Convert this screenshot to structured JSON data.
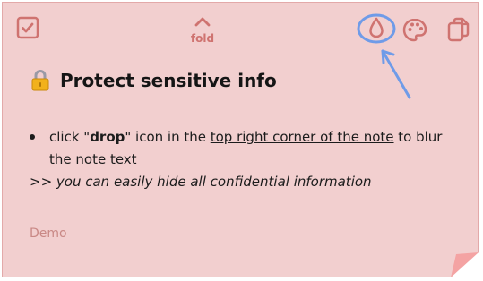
{
  "toolbar": {
    "check_icon": "checkbox-check-icon",
    "fold_icon": "chevron-up-icon",
    "fold_label": "fold",
    "drop_icon": "water-drop-icon",
    "palette_icon": "palette-icon",
    "copy_icon": "copy-icon"
  },
  "note": {
    "title_icon": "lock-icon",
    "title": "Protect sensitive info",
    "bullet_prefix": "click \"",
    "bullet_bold": "drop",
    "bullet_middle": "\" icon in the ",
    "bullet_link": "top right corner of the note",
    "bullet_suffix": " to blur the note text",
    "hint": ">> you can easily hide all confidential information",
    "tag": "Demo"
  },
  "colors": {
    "background": "#f2cfcf",
    "border": "#e3a9a9",
    "icon": "#cf7370",
    "highlight": "#6f9be8",
    "corner": "#f4a3a3"
  }
}
